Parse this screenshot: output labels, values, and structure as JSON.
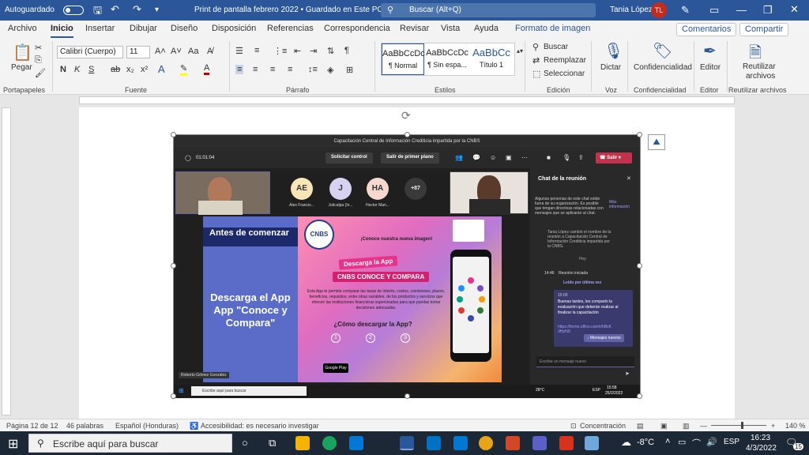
{
  "titlebar": {
    "autosave_label": "Autoguardado",
    "doc_title": "Print de pantalla febrero 2022 • Guardado en Este PC",
    "search_placeholder": "Buscar (Alt+Q)",
    "user_name": "Tania López",
    "user_initials": "TL"
  },
  "menu": {
    "tabs": [
      "Archivo",
      "Inicio",
      "Insertar",
      "Dibujar",
      "Diseño",
      "Disposición",
      "Referencias",
      "Correspondencia",
      "Revisar",
      "Vista",
      "Ayuda",
      "Formato de imagen"
    ],
    "comments_label": "Comentarios",
    "share_label": "Compartir"
  },
  "ribbon": {
    "paste_label": "Pegar",
    "font_name": "Calibri (Cuerpo)",
    "font_size": "11",
    "styles": [
      {
        "preview": "AaBbCcDc",
        "name": "¶ Normal"
      },
      {
        "preview": "AaBbCcDc",
        "name": "¶ Sin espa..."
      },
      {
        "preview": "AaBbCc",
        "name": "Título 1"
      }
    ],
    "find_label": "Buscar",
    "replace_label": "Reemplazar",
    "select_label": "Seleccionar",
    "dictate_label": "Dictar",
    "sensitivity_label": "Confidencialidad",
    "editor_label": "Editor",
    "reuse_label_1": "Reutilizar",
    "reuse_label_2": "archivos",
    "groups": {
      "clipboard": "Portapapeles",
      "font": "Fuente",
      "paragraph": "Párrafo",
      "styles": "Estilos",
      "editing": "Edición",
      "voice": "Voz",
      "sensitivity": "Confidencialidad",
      "editor": "Editor",
      "reuse": "Reutilizar archivos"
    }
  },
  "teams": {
    "window_title": "Capacitación Central de Información Crediticia impartida por la CNBS",
    "timer": "01:01:04",
    "request_control": "Solicitar control",
    "exit_foreground": "Salir de primer plano",
    "leave": "Salir",
    "participants": [
      {
        "initials": "AE",
        "name": "Alex Francis..."
      },
      {
        "initials": "J",
        "name": "Juticalpa (In..."
      },
      {
        "initials": "HA",
        "name": "Hector Man..."
      },
      {
        "initials": "+87",
        "name": ""
      }
    ],
    "presenter_name": "Roberto Gómez González",
    "slide": {
      "left_header": "Antes de comenzar",
      "left_main": "Descarga el App App \"Conoce y Compara\"",
      "logo_text": "CNBS",
      "new_image": "¡Conoce nuestra nueva imagen!",
      "download_pill": "Descarga la App",
      "app_pill": "CNBS CONOCE Y COMPARA",
      "desc": "Esta App te permite comparar las tasas de interés, costos, comisiones, plazos, beneficios, requisitos, entre otras variables, de los productos y servicios que ofrecen las instituciones financieras supervisadas para que puedas tomar decisiones adecuadas.",
      "how_title": "¿Cómo descargar la App?",
      "steps": [
        "1",
        "2",
        "3"
      ],
      "store_label": "Google Play"
    },
    "chat": {
      "title": "Chat de la reunión",
      "notice": "Algunas personas de este chat están fuera de su organización. Es posible que tengan directivas relacionadas con mensajes que se aplicarán al chat.",
      "more_info": "Más información",
      "rename_msg": "Tania López cambió el nombre de la reunión a Capacitación Central de Información Crediticia impartida por la CNBS.",
      "today": "Hoy",
      "meeting_start_time": "14:46",
      "meeting_start": "Reunión iniciada",
      "last_read": "Leído por última vez",
      "msg_time": "15:00",
      "msg_text": "Buenas tardes, les comparto la evaluación que deberán realizar al finalizar la capacitación",
      "msg_link": "https://forms.office.com/r/hBvK dHpNS",
      "new_messages": "Mensajes nuevos",
      "compose_placeholder": "Escribe un mensaje nuevo"
    },
    "inner_taskbar": {
      "search": "Escribe aquí para buscar",
      "temp": "28°C",
      "lang": "ESP",
      "time": "15:58",
      "date": "25/2/2022"
    }
  },
  "statusbar": {
    "page": "Página 12 de 12",
    "words": "46 palabras",
    "lang": "Español (Honduras)",
    "accessibility": "Accesibilidad: es necesario investigar",
    "focus": "Concentración",
    "zoom": "140 %"
  },
  "taskbar": {
    "search_placeholder": "Escribe aquí para buscar",
    "weather": "-8°C",
    "lang": "ESP",
    "time": "16:23",
    "date": "4/3/2022",
    "notifications": "15"
  }
}
